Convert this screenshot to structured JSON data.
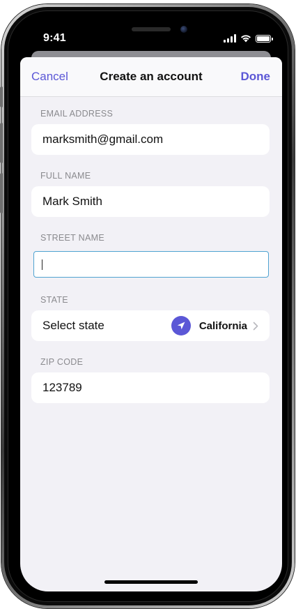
{
  "status_bar": {
    "time": "9:41",
    "icons": [
      "cellular-signal-icon",
      "wifi-icon",
      "battery-icon"
    ]
  },
  "navbar": {
    "cancel_label": "Cancel",
    "title": "Create an account",
    "done_label": "Done"
  },
  "form": {
    "email": {
      "label": "EMAIL ADDRESS",
      "value": "marksmith@gmail.com"
    },
    "full_name": {
      "label": "FULL NAME",
      "value": "Mark Smith"
    },
    "street": {
      "label": "STREET NAME",
      "value": ""
    },
    "state": {
      "label": "STATE",
      "prompt": "Select state",
      "value": "California",
      "icon": "location-arrow-icon"
    },
    "zip": {
      "label": "ZIP CODE",
      "value": "123789"
    }
  },
  "colors": {
    "accent": "#5b57d6",
    "background": "#f2f1f6",
    "field_background": "#ffffff",
    "label_gray": "#8a8a8e",
    "active_border": "#4fa3d1"
  }
}
